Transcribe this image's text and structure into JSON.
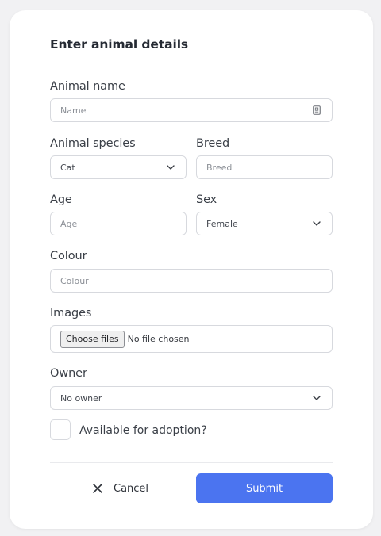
{
  "form": {
    "title": "Enter animal details",
    "animal_name": {
      "label": "Animal name",
      "placeholder": "Name",
      "icon": "contact-card-icon"
    },
    "species": {
      "label": "Animal species",
      "value": "Cat"
    },
    "breed": {
      "label": "Breed",
      "placeholder": "Breed"
    },
    "age": {
      "label": "Age",
      "placeholder": "Age"
    },
    "sex": {
      "label": "Sex",
      "value": "Female"
    },
    "colour": {
      "label": "Colour",
      "placeholder": "Colour"
    },
    "images": {
      "label": "Images",
      "button_label": "Choose files",
      "status": "No file chosen"
    },
    "owner": {
      "label": "Owner",
      "value": "No owner"
    },
    "adoption": {
      "label": "Available for adoption?",
      "checked": false
    }
  },
  "actions": {
    "cancel_label": "Cancel",
    "submit_label": "Submit",
    "submit_color": "#4b74f0"
  }
}
